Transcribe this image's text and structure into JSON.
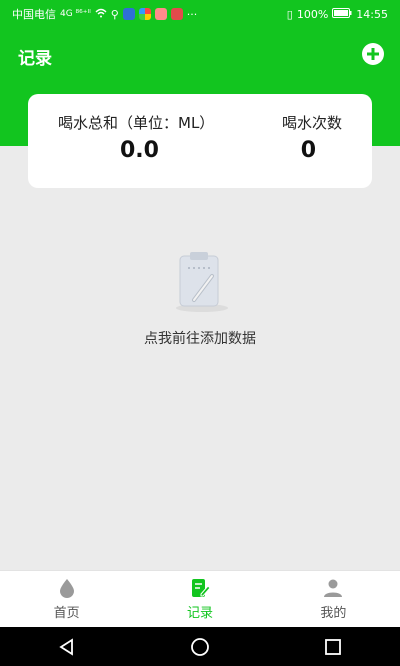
{
  "status_bar": {
    "carrier": "中国电信",
    "signal_icons": "4G ⁸⁶⁺ᴵˡ",
    "more": "···",
    "battery": "100%",
    "time": "14:55"
  },
  "header": {
    "title": "记录"
  },
  "stats": {
    "total_label": "喝水总和（单位：ML）",
    "total_value": "0.0",
    "count_label": "喝水次数",
    "count_value": "0"
  },
  "empty_state": {
    "text": "点我前往添加数据"
  },
  "bottom_nav": {
    "items": [
      {
        "label": "首页",
        "icon": "water-drop-icon"
      },
      {
        "label": "记录",
        "icon": "note-edit-icon"
      },
      {
        "label": "我的",
        "icon": "user-icon"
      }
    ],
    "active_index": 1
  },
  "colors": {
    "primary": "#12c51f",
    "background": "#ebebeb"
  }
}
